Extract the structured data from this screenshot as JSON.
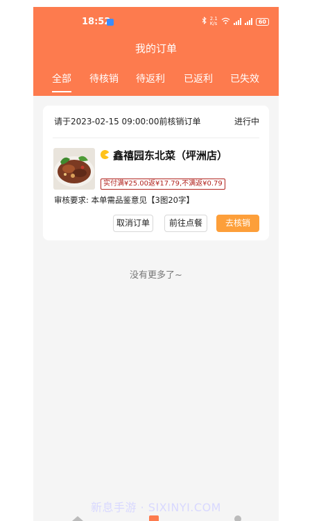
{
  "status_bar": {
    "time": "18:52",
    "network_speed_top": "2.1",
    "network_speed_bottom": "K/s",
    "battery": "60"
  },
  "header": {
    "title": "我的订单",
    "tabs": [
      {
        "label": "全部",
        "active": true
      },
      {
        "label": "待核销",
        "active": false
      },
      {
        "label": "待返利",
        "active": false
      },
      {
        "label": "已返利",
        "active": false
      },
      {
        "label": "已失效",
        "active": false
      }
    ]
  },
  "order": {
    "request_text": "请于2023-02-15 09:00:00前核销订单",
    "status": "进行中",
    "shop_name": "鑫禧园东北菜（坪洲店）",
    "rebate_tag": "实付满¥25.00返¥17.79,不满返¥0.79",
    "review_requirement": "审核要求:  本单需品鉴意见【3图20字】",
    "buttons": {
      "cancel": "取消订单",
      "goto_order": "前往点餐",
      "verify": "去核销"
    }
  },
  "footer_text": "没有更多了~",
  "watermark": "新息手游 · SIXINYI.COM",
  "colors": {
    "header_bg": "#fd7b4e",
    "primary_button": "#fd9f3a",
    "rebate_border": "#b0211c",
    "page_bg": "#f5f5f5"
  },
  "icons": {
    "shop": "shop-icon",
    "wifi": "wifi-icon",
    "bluetooth": "bluetooth-icon",
    "signal": "signal-icon",
    "battery": "battery-icon"
  }
}
